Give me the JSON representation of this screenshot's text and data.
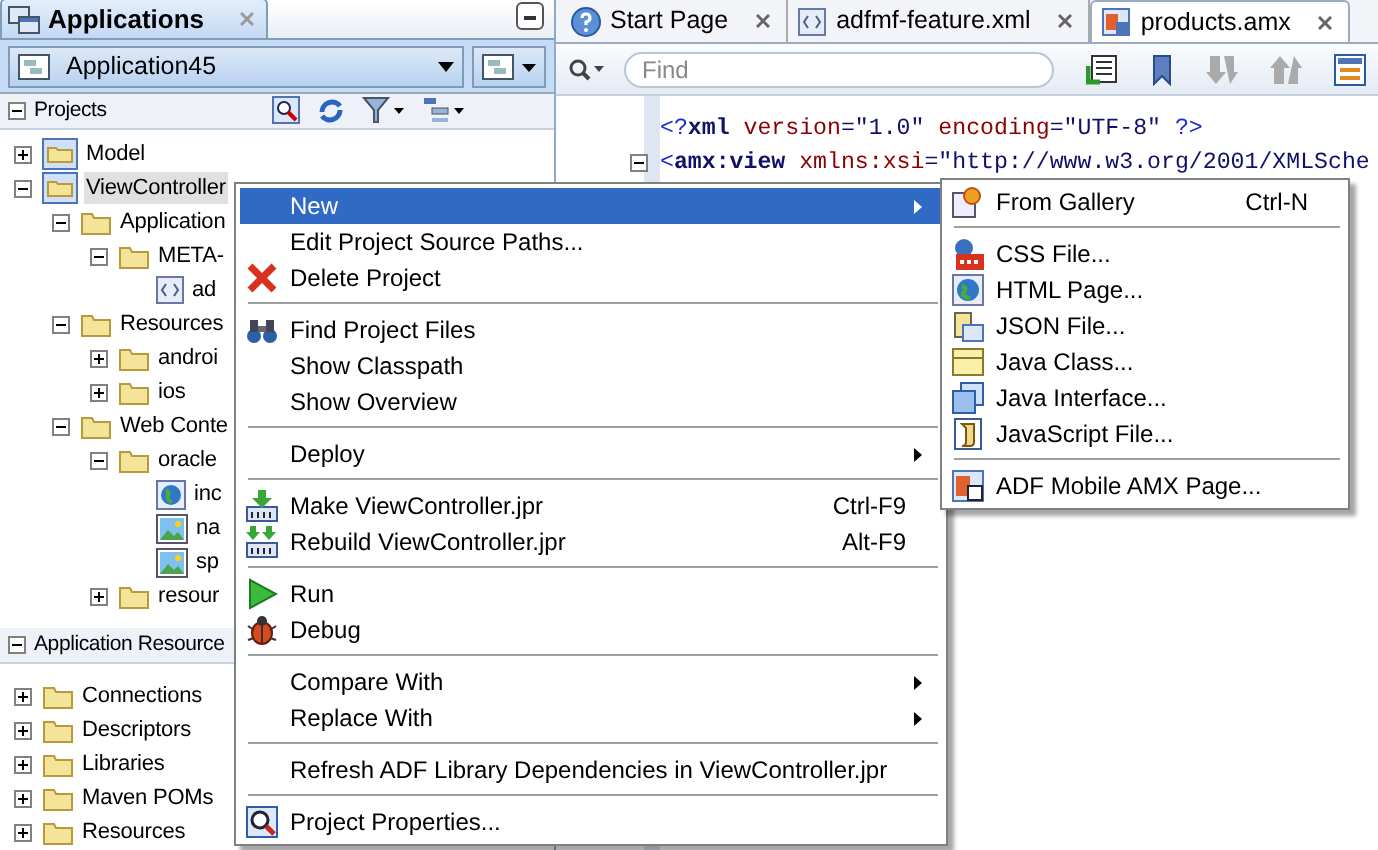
{
  "left_panel": {
    "tab": {
      "title": "Applications"
    },
    "application_selector": {
      "value": "Application45"
    },
    "projects_header": {
      "title": "Projects",
      "expanded": true
    },
    "project_tree": [
      {
        "label": "Model",
        "kind": "project",
        "selected": false,
        "expanded": false
      },
      {
        "label": "ViewController",
        "kind": "project",
        "selected": true,
        "expanded": true,
        "children": [
          {
            "label": "Application",
            "kind": "folder",
            "selected": false,
            "expanded": true,
            "children": [
              {
                "label": "META-",
                "kind": "folder",
                "selected": false,
                "expanded": true,
                "children": [
                  {
                    "label": "ad",
                    "kind": "xml-file",
                    "selected": false
                  }
                ]
              }
            ]
          },
          {
            "label": "Resources",
            "kind": "folder",
            "selected": false,
            "expanded": true,
            "children": [
              {
                "label": "androi",
                "kind": "folder",
                "selected": false,
                "expanded": false
              },
              {
                "label": "ios",
                "kind": "folder",
                "selected": false,
                "expanded": false
              }
            ]
          },
          {
            "label": "Web Conte",
            "kind": "folder",
            "selected": false,
            "expanded": true,
            "children": [
              {
                "label": "oracle",
                "kind": "folder",
                "selected": false,
                "expanded": true,
                "children": [
                  {
                    "label": "inc",
                    "kind": "web-file",
                    "selected": false
                  },
                  {
                    "label": "na",
                    "kind": "image-file",
                    "selected": false
                  },
                  {
                    "label": "sp",
                    "kind": "image-file",
                    "selected": false
                  }
                ]
              },
              {
                "label": "resour",
                "kind": "folder",
                "selected": false,
                "expanded": false
              }
            ]
          }
        ]
      }
    ],
    "resources_header": {
      "title": "Application Resource",
      "expanded": true
    },
    "resources_tree": [
      {
        "label": "Connections",
        "kind": "folder",
        "selected": false,
        "expanded": false
      },
      {
        "label": "Descriptors",
        "kind": "folder",
        "selected": false,
        "expanded": false
      },
      {
        "label": "Libraries",
        "kind": "folder",
        "selected": false,
        "expanded": false
      },
      {
        "label": "Maven POMs",
        "kind": "folder",
        "selected": false,
        "expanded": false
      },
      {
        "label": "Resources",
        "kind": "folder",
        "selected": false,
        "expanded": false
      }
    ]
  },
  "editor": {
    "tabs": [
      {
        "label": "Start Page",
        "kind": "help",
        "selected": false
      },
      {
        "label": "adfmf-feature.xml",
        "kind": "xml",
        "selected": false
      },
      {
        "label": "products.amx",
        "kind": "amx",
        "selected": true
      }
    ],
    "search": {
      "placeholder": "Find"
    },
    "lines": [
      {
        "tokens": [
          {
            "kind": "punct",
            "text": "<?"
          },
          {
            "kind": "tag",
            "text": "xml"
          },
          {
            "kind": "attr",
            "text": " version"
          },
          {
            "kind": "value",
            "text": "=\"1.0\""
          },
          {
            "kind": "attr",
            "text": " encoding"
          },
          {
            "kind": "value",
            "text": "=\"UTF-8\""
          },
          {
            "kind": "punct",
            "text": " ?>"
          }
        ]
      },
      {
        "expanded": true,
        "tokens": [
          {
            "kind": "punct",
            "text": "<"
          },
          {
            "kind": "tag",
            "text": "amx:view"
          },
          {
            "kind": "attr",
            "text": " xmlns:xsi"
          },
          {
            "kind": "value",
            "text": "=\"http://www.w3.org/2001/XMLSche"
          }
        ]
      }
    ]
  },
  "context_menu": {
    "groups": [
      [
        {
          "label": "New",
          "submenu": true,
          "selected": true
        },
        {
          "label": "Edit Project Source Paths...",
          "selected": false
        },
        {
          "label": "Delete Project",
          "selected": false
        }
      ],
      [
        {
          "label": "Find Project Files",
          "selected": false
        },
        {
          "label": "Show Classpath",
          "selected": false
        },
        {
          "label": "Show Overview",
          "selected": false
        }
      ],
      [
        {
          "label": "Deploy",
          "submenu": true,
          "selected": false
        }
      ],
      [
        {
          "label": "Make ViewController.jpr",
          "shortcut": "Ctrl-F9",
          "selected": false
        },
        {
          "label": "Rebuild ViewController.jpr",
          "shortcut": "Alt-F9",
          "selected": false
        }
      ],
      [
        {
          "label": "Run",
          "selected": false
        },
        {
          "label": "Debug",
          "selected": false
        }
      ],
      [
        {
          "label": "Compare With",
          "submenu": true,
          "selected": false
        },
        {
          "label": "Replace With",
          "submenu": true,
          "selected": false
        }
      ],
      [
        {
          "label": "Refresh ADF Library Dependencies in ViewController.jpr",
          "selected": false
        }
      ],
      [
        {
          "label": "Project Properties...",
          "selected": false
        }
      ]
    ]
  },
  "new_submenu": {
    "groups": [
      [
        {
          "label": "From Gallery",
          "shortcut": "Ctrl-N",
          "selected": false
        }
      ],
      [
        {
          "label": "CSS File...",
          "selected": false
        },
        {
          "label": "HTML Page...",
          "selected": false
        },
        {
          "label": "JSON File...",
          "selected": false
        },
        {
          "label": "Java Class...",
          "selected": false
        },
        {
          "label": "Java Interface...",
          "selected": false
        },
        {
          "label": "JavaScript File...",
          "selected": false
        }
      ],
      [
        {
          "label": "ADF Mobile AMX Page...",
          "selected": false
        }
      ]
    ]
  }
}
